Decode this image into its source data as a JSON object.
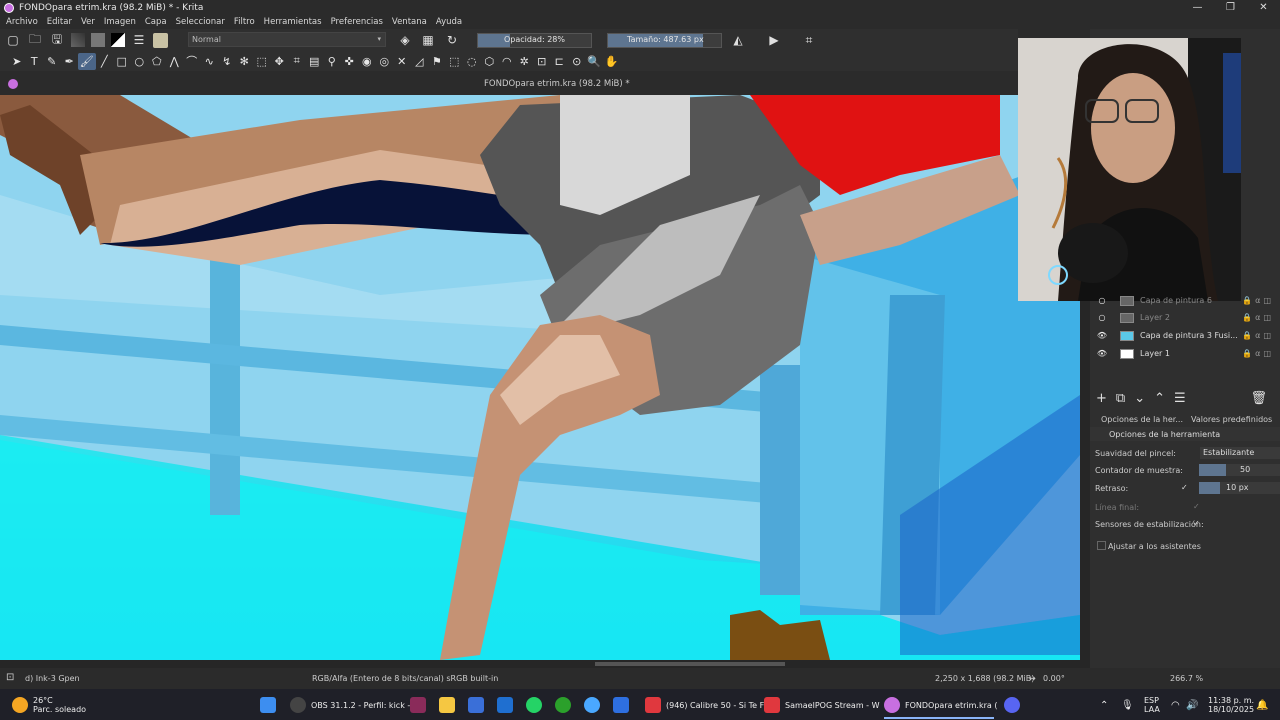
{
  "window": {
    "title": "FONDOpara etrim.kra (98.2 MiB) * - Krita",
    "controls": [
      "—",
      "❐",
      "✕"
    ]
  },
  "menu": [
    "Archivo",
    "Editar",
    "Ver",
    "Imagen",
    "Capa",
    "Seleccionar",
    "Filtro",
    "Herramientas",
    "Preferencias",
    "Ventana",
    "Ayuda"
  ],
  "toolbar": {
    "blend_mode": "Normal",
    "opacity_label": "Opacidad: 28%",
    "opacity_value": 0.28,
    "size_label": "Tamaño: 487.63 px"
  },
  "document_tab": "FONDOpara etrim.kra (98.2 MiB) *",
  "layers": [
    {
      "name": "Capa de pintura 6",
      "visible": false
    },
    {
      "name": "Layer 2",
      "visible": false
    },
    {
      "name": "Capa de pintura 3 Fusi...",
      "visible": true
    },
    {
      "name": "Layer 1",
      "visible": true
    }
  ],
  "panel_tabs": {
    "tool_options_tab": "Opciones de la her...",
    "presets_tab": "Valores predefinidos ..."
  },
  "tool_options": {
    "header": "Opciones de la herramienta",
    "smoothing_label": "Suavidad del pincel:",
    "smoothing_value": "Estabilizante",
    "sample_label": "Contador de muestra:",
    "sample_value": "50",
    "delay_label": "Retraso:",
    "delay_value": "10 px",
    "end_line_label": "Línea final:",
    "sensors_label": "Sensores de estabilización:",
    "assist_label": "Ajustar a los asistentes"
  },
  "status": {
    "brush": "d) Ink-3 Gpen",
    "color_space": "RGB/Alfa (Entero de 8 bits/canal)  sRGB built-in",
    "dimensions": "2,250 x 1,688 (98.2 MiB)",
    "rotation": "0.00°",
    "zoom": "266.7 %"
  },
  "taskbar": {
    "weather_temp": "26°C",
    "weather_desc": "Parc. soleado",
    "apps": [
      {
        "label": "OBS 31.1.2 - Perfil: kick -",
        "color": "#444"
      },
      {
        "label": "(946) Calibre 50 - Si Te F",
        "color": "#e0383e"
      },
      {
        "label": "SamaelPOG Stream - W",
        "color": "#e0383e"
      },
      {
        "label": "FONDOpara etrim.kra (",
        "color": "#c86fe0"
      }
    ],
    "lang": "ESP",
    "lang_sub": "LAA",
    "time": "11:38 p. m.",
    "date": "18/10/2025"
  }
}
